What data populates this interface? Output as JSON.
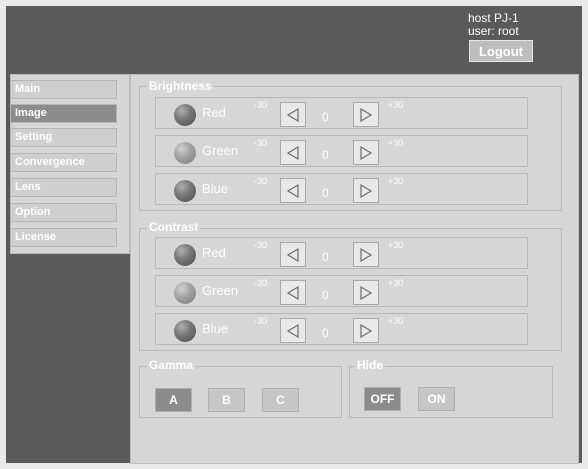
{
  "header": {
    "host": "host PJ-1",
    "user": "user: root",
    "logout_label": "Logout"
  },
  "sidebar": {
    "items": [
      {
        "label": "Main",
        "active": false
      },
      {
        "label": "Image",
        "active": true
      },
      {
        "label": "Setting",
        "active": false
      },
      {
        "label": "Convergence",
        "active": false
      },
      {
        "label": "Lens",
        "active": false
      },
      {
        "label": "Option",
        "active": false
      },
      {
        "label": "License",
        "active": false
      }
    ]
  },
  "brightness": {
    "title": "Brightness",
    "rows": [
      {
        "label": "Red",
        "min": "-30",
        "value": "0",
        "max": "+30"
      },
      {
        "label": "Green",
        "min": "-30",
        "value": "0",
        "max": "+30"
      },
      {
        "label": "Blue",
        "min": "-30",
        "value": "0",
        "max": "+30"
      }
    ]
  },
  "contrast": {
    "title": "Contrast",
    "rows": [
      {
        "label": "Red",
        "min": "-30",
        "value": "0",
        "max": "+30"
      },
      {
        "label": "Green",
        "min": "-30",
        "value": "0",
        "max": "+30"
      },
      {
        "label": "Blue",
        "min": "-30",
        "value": "0",
        "max": "+30"
      }
    ]
  },
  "gamma": {
    "title": "Gamma",
    "options": [
      "A",
      "B",
      "C"
    ],
    "selected": "A"
  },
  "hide": {
    "title": "Hide",
    "options": [
      "OFF",
      "ON"
    ],
    "selected": "OFF"
  },
  "colors": {
    "frame": "#5a5a5a",
    "panel": "#d6d6d6",
    "selected": "#8c8c8c"
  }
}
